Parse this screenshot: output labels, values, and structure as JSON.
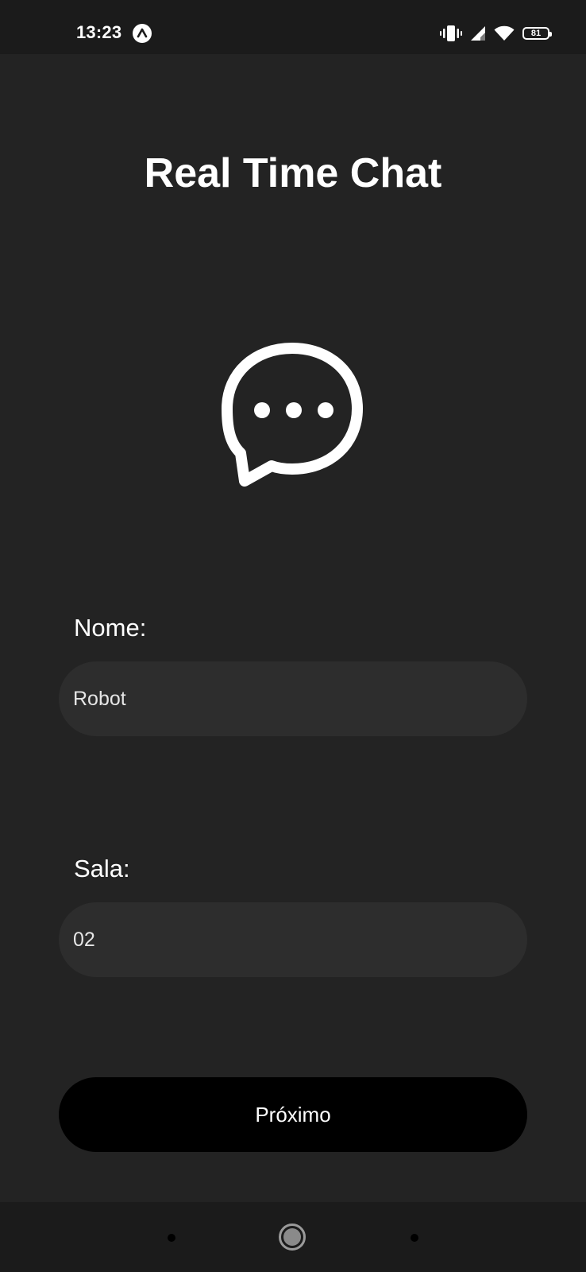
{
  "status_bar": {
    "time": "13:23",
    "app_icon": "chevron-up-circle-icon",
    "icons": [
      "vibrate-icon",
      "cell-signal-icon",
      "wifi-icon",
      "battery-icon"
    ],
    "battery_level": "81"
  },
  "header": {
    "title": "Real Time Chat"
  },
  "hero": {
    "icon": "chat-bubble-icon"
  },
  "form": {
    "name_label": "Nome:",
    "name_value": "Robot",
    "room_label": "Sala:",
    "room_value": "02",
    "next_label": "Próximo"
  },
  "nav_bar": {
    "icons": [
      "back-icon",
      "home-icon",
      "recents-icon"
    ]
  },
  "colors": {
    "background": "#232323",
    "input_background": "#2d2d2d",
    "button_background": "#000000",
    "text": "#ffffff"
  }
}
